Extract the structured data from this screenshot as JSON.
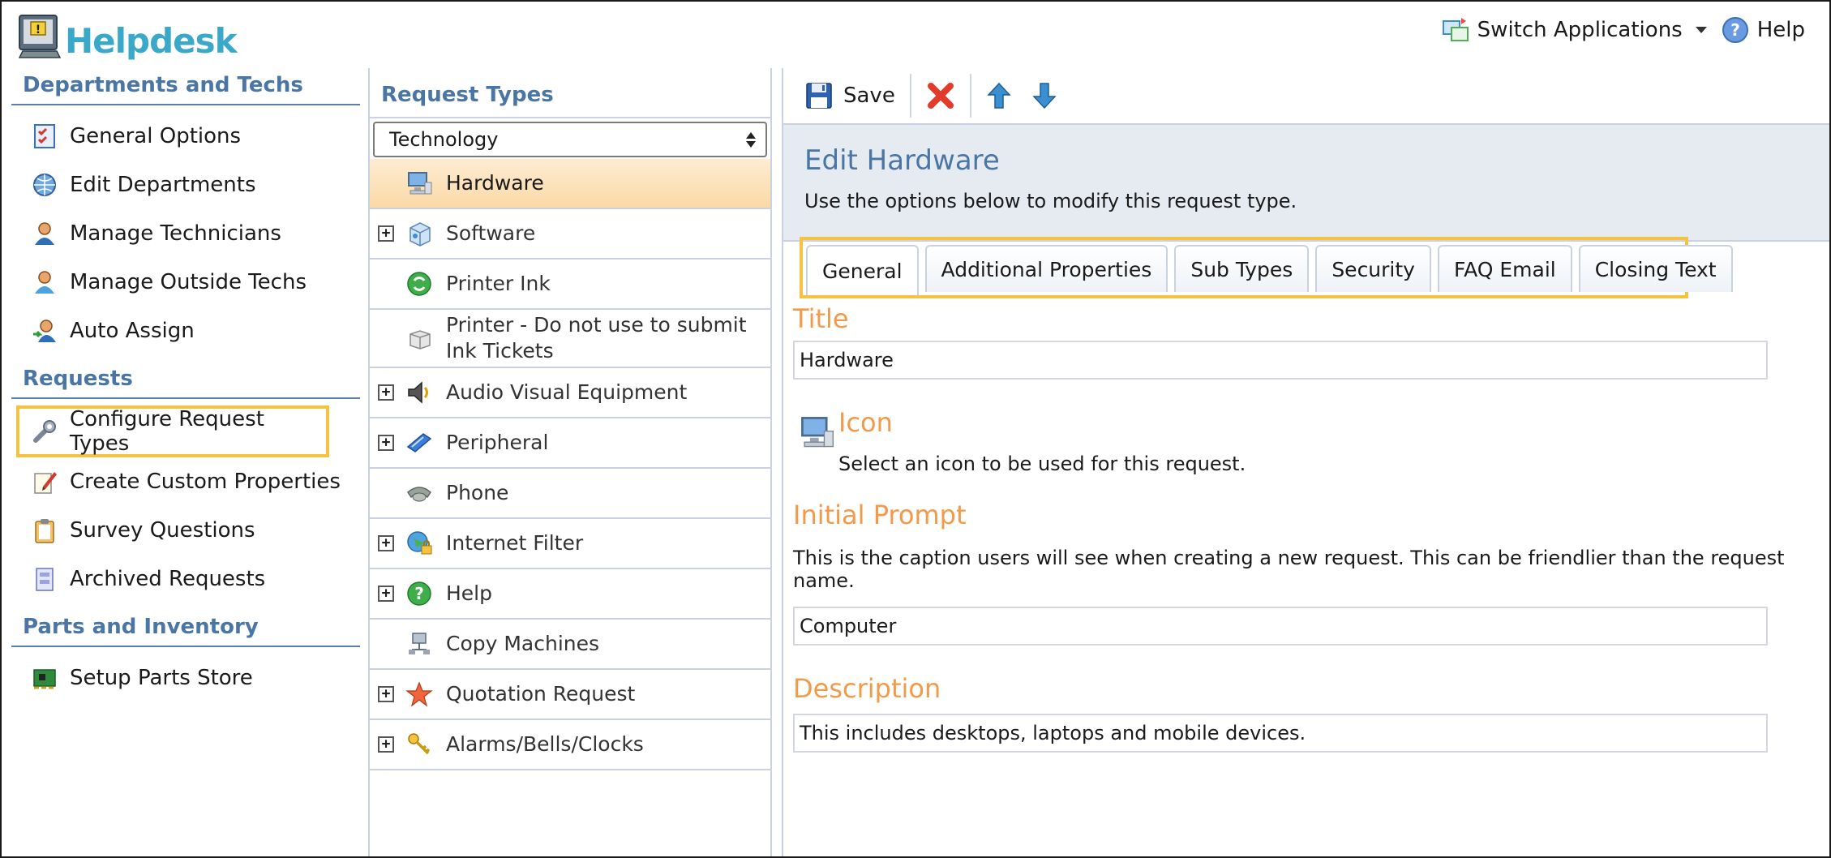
{
  "app": {
    "title": "Helpdesk",
    "switch_apps_label": "Switch Applications",
    "help_label": "Help"
  },
  "colors": {
    "accent_blue": "#4a76a5",
    "logo_teal": "#3aa9c9",
    "highlight": "#f5c242",
    "label_orange": "#f29a4a",
    "selected_row": "#fbd9a6"
  },
  "sidebar": {
    "sections": [
      {
        "title": "Departments and Techs",
        "items": [
          {
            "label": "General Options",
            "icon": "checklist-icon"
          },
          {
            "label": "Edit Departments",
            "icon": "globe-icon"
          },
          {
            "label": "Manage Technicians",
            "icon": "user-icon"
          },
          {
            "label": "Manage Outside Techs",
            "icon": "user-outside-icon"
          },
          {
            "label": "Auto Assign",
            "icon": "auto-assign-icon"
          }
        ]
      },
      {
        "title": "Requests",
        "items": [
          {
            "label": "Configure Request Types",
            "icon": "wrench-icon",
            "highlighted": true
          },
          {
            "label": "Create Custom Properties",
            "icon": "pencil-note-icon"
          },
          {
            "label": "Survey Questions",
            "icon": "clipboard-icon"
          },
          {
            "label": "Archived Requests",
            "icon": "archive-icon"
          }
        ]
      },
      {
        "title": "Parts and Inventory",
        "items": [
          {
            "label": "Setup Parts Store",
            "icon": "circuit-board-icon"
          }
        ]
      }
    ]
  },
  "request_types": {
    "title": "Request Types",
    "category_selected": "Technology",
    "items": [
      {
        "label": "Hardware",
        "expandable": false,
        "selected": true,
        "icon": "computer-icon"
      },
      {
        "label": "Software",
        "expandable": true,
        "icon": "software-box-icon"
      },
      {
        "label": "Printer Ink",
        "expandable": false,
        "icon": "recycle-icon"
      },
      {
        "label": "Printer - Do not use to submit Ink Tickets",
        "expandable": false,
        "icon": "printer-icon"
      },
      {
        "label": "Audio Visual Equipment",
        "expandable": true,
        "icon": "speaker-icon"
      },
      {
        "label": "Peripheral",
        "expandable": true,
        "icon": "scanner-icon"
      },
      {
        "label": "Phone",
        "expandable": false,
        "icon": "phone-icon"
      },
      {
        "label": "Internet Filter",
        "expandable": true,
        "icon": "globe-lock-icon"
      },
      {
        "label": "Help",
        "expandable": true,
        "icon": "help-icon"
      },
      {
        "label": "Copy Machines",
        "expandable": false,
        "icon": "network-icon"
      },
      {
        "label": "Quotation Request",
        "expandable": true,
        "icon": "star-icon"
      },
      {
        "label": "Alarms/Bells/Clocks",
        "expandable": true,
        "icon": "keys-icon"
      }
    ]
  },
  "toolbar": {
    "save_label": "Save"
  },
  "editor": {
    "title": "Edit Hardware",
    "description": "Use the options below to modify this request type.",
    "tabs": [
      {
        "label": "General",
        "active": true
      },
      {
        "label": "Additional Properties"
      },
      {
        "label": "Sub Types"
      },
      {
        "label": "Security"
      },
      {
        "label": "FAQ Email"
      },
      {
        "label": "Closing Text"
      }
    ],
    "title_label": "Title",
    "title_value": "Hardware",
    "icon_label": "Icon",
    "icon_help": "Select an icon to be used for this request.",
    "prompt_label": "Initial Prompt",
    "prompt_help": "This is the caption users will see when creating a new request. This can be friendlier than the request name.",
    "prompt_value": "Computer",
    "description_label": "Description",
    "description_value": "This includes desktops, laptops and mobile devices."
  }
}
